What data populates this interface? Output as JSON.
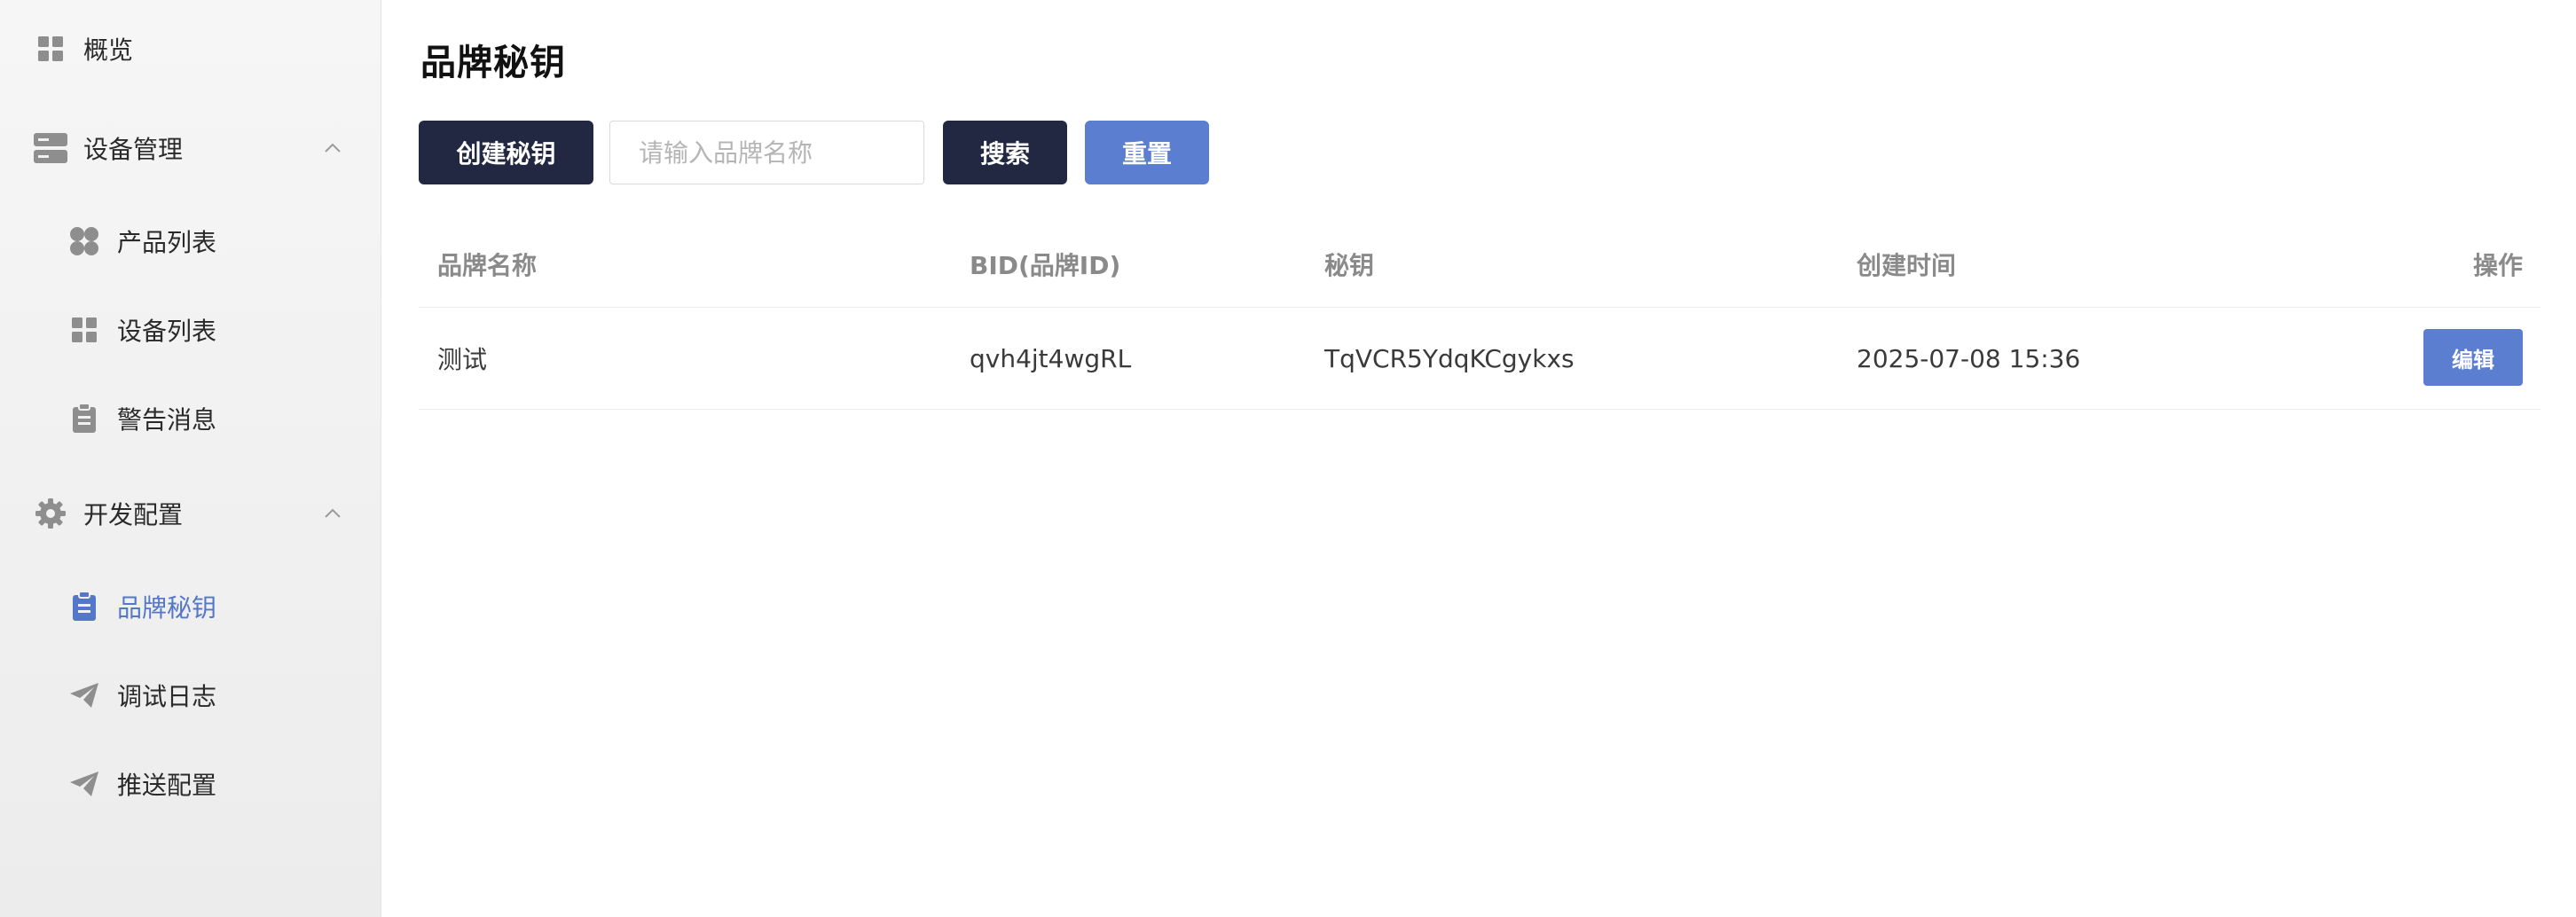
{
  "sidebar": {
    "overview": {
      "label": "概览",
      "icon": "grid-icon"
    },
    "device_mgmt": {
      "label": "设备管理",
      "icon": "server-icon",
      "expanded": true
    },
    "product_list": {
      "label": "产品列表",
      "icon": "clover-icon"
    },
    "device_list": {
      "label": "设备列表",
      "icon": "grid-icon"
    },
    "alert_msgs": {
      "label": "警告消息",
      "icon": "clipboard-icon"
    },
    "dev_config": {
      "label": "开发配置",
      "icon": "gear-icon",
      "expanded": true
    },
    "brand_keys": {
      "label": "品牌秘钥",
      "icon": "clipboard-icon",
      "active": true
    },
    "debug_logs": {
      "label": "调试日志",
      "icon": "send-icon"
    },
    "push_config": {
      "label": "推送配置",
      "icon": "send-icon"
    }
  },
  "page": {
    "title": "品牌秘钥"
  },
  "toolbar": {
    "create_label": "创建秘钥",
    "search_placeholder": "请输入品牌名称",
    "search_value": "",
    "search_label": "搜索",
    "reset_label": "重置"
  },
  "table": {
    "headers": {
      "brand_name": "品牌名称",
      "bid": "BID(品牌ID)",
      "secret": "秘钥",
      "created_at": "创建时间",
      "actions": "操作"
    },
    "rows": [
      {
        "brand_name": "测试",
        "bid": "qvh4jt4wgRL",
        "secret": "TqVCR5YdqKCgykxs",
        "created_at": "2025-07-08 15:36",
        "action_label": "编辑"
      }
    ]
  },
  "colors": {
    "accent_blue": "#5b7ed0",
    "dark_button": "#232842",
    "active_nav": "#5577c9"
  }
}
